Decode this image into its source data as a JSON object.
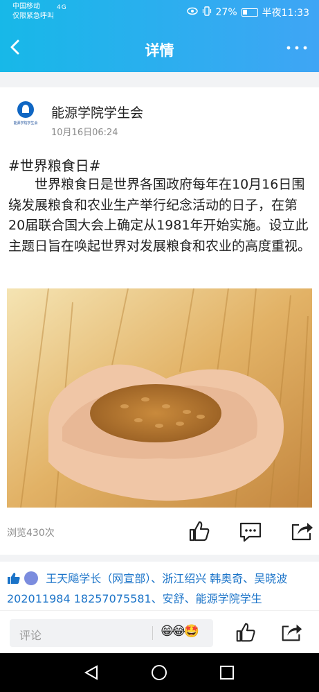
{
  "status_bar": {
    "carrier_line1": "中国移动",
    "carrier_line2": "仅限紧急呼叫",
    "network": "4G",
    "battery": "27%",
    "time": "半夜11:33"
  },
  "header": {
    "title": "详情"
  },
  "post": {
    "author": "能源学院学生会",
    "avatar_caption": "能源学院学生会",
    "time": "10月16日06:24",
    "hashtag": "#世界粮食日#",
    "body": "世界粮食日是世界各国政府每年在10月16日围绕发展粮食和农业生产举行纪念活动的日子，在第20届联合国大会上确定从1981年开始实施。设立此主题日旨在唤起世界对发展粮食和农业的高度重视。",
    "views": "浏览430次"
  },
  "likes": {
    "text": "王天飚学长（网宣部）、浙江绍兴 韩奥奇、吴晓波 202011984  18257075581、安舒、能源学院学生"
  },
  "bottom_bar": {
    "comment_placeholder": "评论",
    "emoji": "😁😂🤩"
  },
  "colors": {
    "header_start": "#17b8e8",
    "header_end": "#3fa5f5",
    "link_blue": "#1a73c8"
  }
}
